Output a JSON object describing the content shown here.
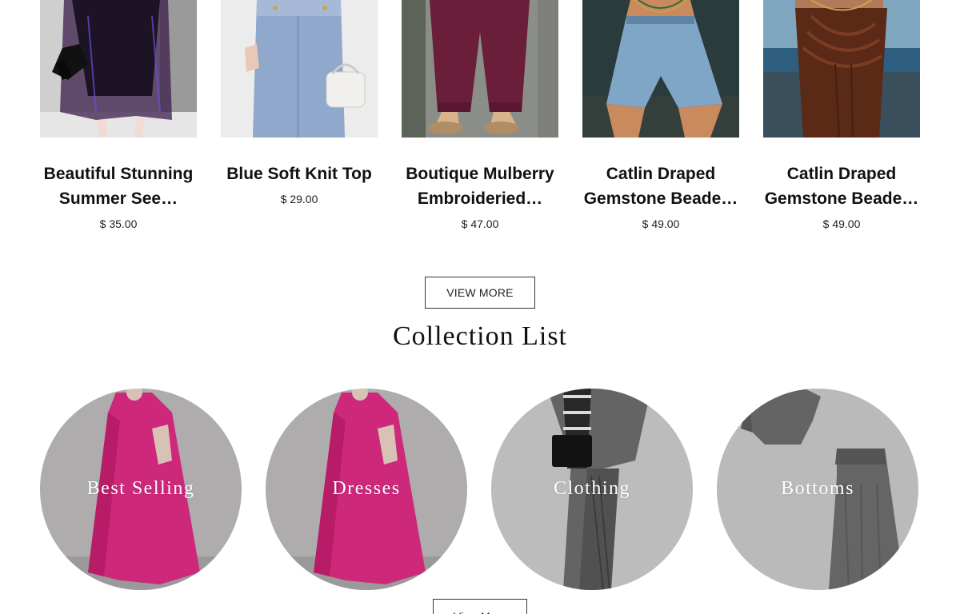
{
  "products": [
    {
      "title": "Beautiful Stunning Summer See-Through Coat",
      "title_display": "Beautiful Stunning Summer See…",
      "price": "$ 35.00",
      "image": "sheer-purple-coat-photo"
    },
    {
      "title": "Blue Soft Knit Top",
      "title_display": "Blue Soft Knit Top",
      "price": "$ 29.00",
      "image": "blue-knit-skirt-photo"
    },
    {
      "title": "Boutique Mulberry Embroidered Pants",
      "title_display": "Boutique Mulberry Embroideried…",
      "price": "$ 47.00",
      "image": "mulberry-pants-photo"
    },
    {
      "title": "Catlin Draped Gemstone Beaded Shorts",
      "title_display": "Catlin Draped Gemstone Beade…",
      "price": "$ 49.00",
      "image": "denim-shorts-photo"
    },
    {
      "title": "Catlin Draped Gemstone Beaded Skirt",
      "title_display": "Catlin Draped Gemstone Beade…",
      "price": "$ 49.00",
      "image": "brown-skirt-photo"
    }
  ],
  "view_more_label": "VIEW MORE",
  "collection_list": {
    "title": "Collection List",
    "items": [
      {
        "label": "Best Selling",
        "image": "pink-dress-photo"
      },
      {
        "label": "Dresses",
        "image": "pink-dress-photo"
      },
      {
        "label": "Clothing",
        "image": "grey-plaid-outfit-photo"
      },
      {
        "label": "Bottoms",
        "image": "grey-top-and-skirt-photo"
      }
    ],
    "view_more_label": "View More"
  }
}
